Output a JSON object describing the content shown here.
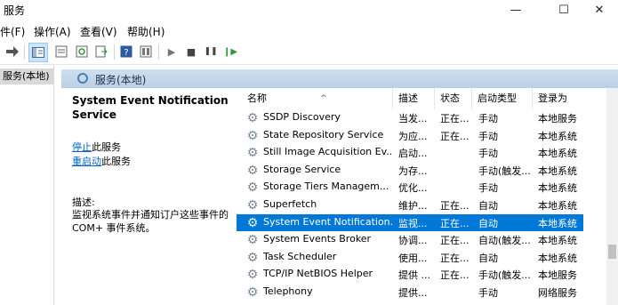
{
  "window": {
    "title": "服务",
    "controls": {
      "minimize": "—",
      "maximize": "☐",
      "close": "✕"
    }
  },
  "menu": [
    {
      "label": "件(F)"
    },
    {
      "label": "操作(A)"
    },
    {
      "label": "查看(V)"
    },
    {
      "label": "帮助(H)"
    }
  ],
  "toolbar": {
    "forward_icon": "forward-arrow-icon",
    "selected_tool": "show-hide-console-tree",
    "play_symbol": "▶",
    "stop_symbol": "■",
    "pause_symbol": "❚❚",
    "restart_symbol": "❙▶"
  },
  "tree": {
    "root_label": "服务(本地)"
  },
  "panel_header": {
    "label": "服务(本地)"
  },
  "detail": {
    "service_title": "System Event Notification Service",
    "stop_link": "停止",
    "stop_suffix": "此服务",
    "restart_link": "重启动",
    "restart_suffix": "此服务",
    "desc_label": "描述:",
    "desc_text": "监视系统事件并通知订户这些事件的 COM+ 事件系统。"
  },
  "columns": {
    "name": "名称",
    "desc": "描述",
    "status": "状态",
    "startup": "启动类型",
    "logon": "登录为"
  },
  "services": [
    {
      "name": "SSDP Discovery",
      "desc": "当发...",
      "status": "正在...",
      "startup": "手动",
      "logon": "本地服务"
    },
    {
      "name": "State Repository Service",
      "desc": "为应...",
      "status": "正在...",
      "startup": "手动",
      "logon": "本地系统"
    },
    {
      "name": "Still Image Acquisition Ev...",
      "desc": "启动...",
      "status": "",
      "startup": "手动",
      "logon": "本地系统"
    },
    {
      "name": "Storage Service",
      "desc": "为存...",
      "status": "",
      "startup": "手动(触发...",
      "logon": "本地系统"
    },
    {
      "name": "Storage Tiers Managem...",
      "desc": "优化...",
      "status": "",
      "startup": "手动",
      "logon": "本地系统"
    },
    {
      "name": "Superfetch",
      "desc": "维护...",
      "status": "正在...",
      "startup": "自动",
      "logon": "本地系统"
    },
    {
      "name": "System Event Notification...",
      "desc": "监视...",
      "status": "正在...",
      "startup": "自动",
      "logon": "本地系统"
    },
    {
      "name": "System Events Broker",
      "desc": "协调...",
      "status": "正在...",
      "startup": "自动(触发...",
      "logon": "本地系统"
    },
    {
      "name": "Task Scheduler",
      "desc": "使用...",
      "status": "正在...",
      "startup": "自动",
      "logon": "本地系统"
    },
    {
      "name": "TCP/IP NetBIOS Helper",
      "desc": "提供 ...",
      "status": "正在...",
      "startup": "手动(触发...",
      "logon": "本地服务"
    },
    {
      "name": "Telephony",
      "desc": "提供...",
      "status": "",
      "startup": "手动",
      "logon": "网络服务"
    }
  ],
  "selected_row_index": 6,
  "colors": {
    "selection": "#0078d7",
    "header_gradient_top": "#cfe0f0",
    "link": "#0066cc"
  }
}
